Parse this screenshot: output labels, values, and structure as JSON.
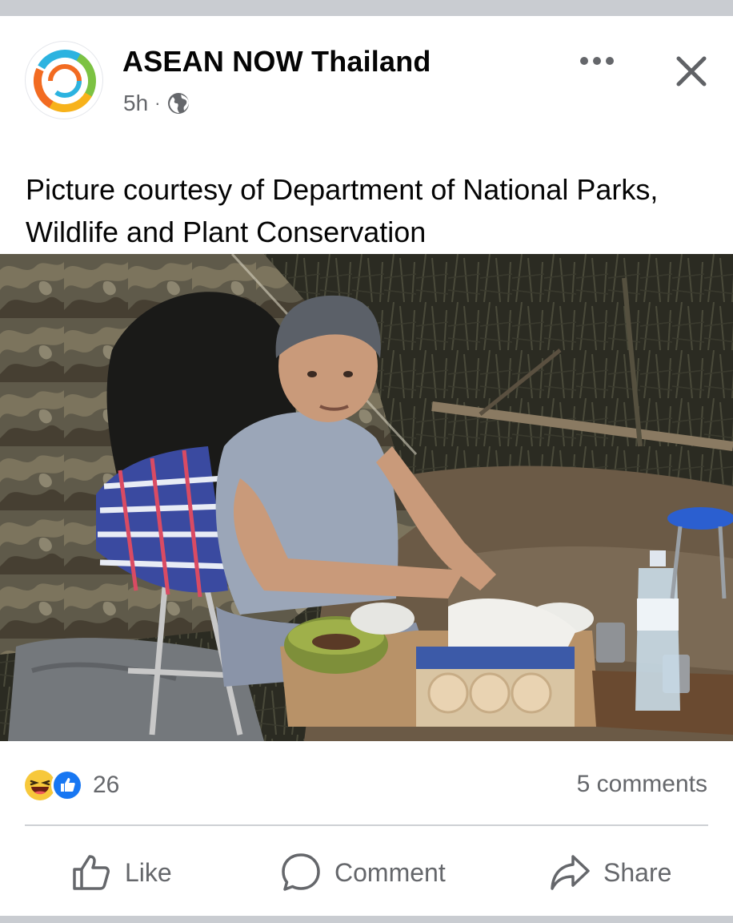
{
  "post": {
    "page_name": "ASEAN NOW Thailand",
    "time": "5h",
    "separator": "·",
    "audience_icon": "globe-icon",
    "caption": "Picture courtesy of Department of National Parks, Wildlife and Plant Conservation",
    "more_icon": "more-horizontal-icon",
    "close_icon": "close-icon"
  },
  "engagement": {
    "reaction_icons": [
      "laugh-reaction-icon",
      "like-reaction-icon"
    ],
    "reaction_count": "26",
    "comments": "5 comments"
  },
  "actions": {
    "like": "Like",
    "comment": "Comment",
    "share": "Share"
  },
  "colors": {
    "like_blue": "#1877f2",
    "secondary_text": "#65676b",
    "divider": "#ced0d4",
    "feed_background": "#c9ccd1"
  }
}
